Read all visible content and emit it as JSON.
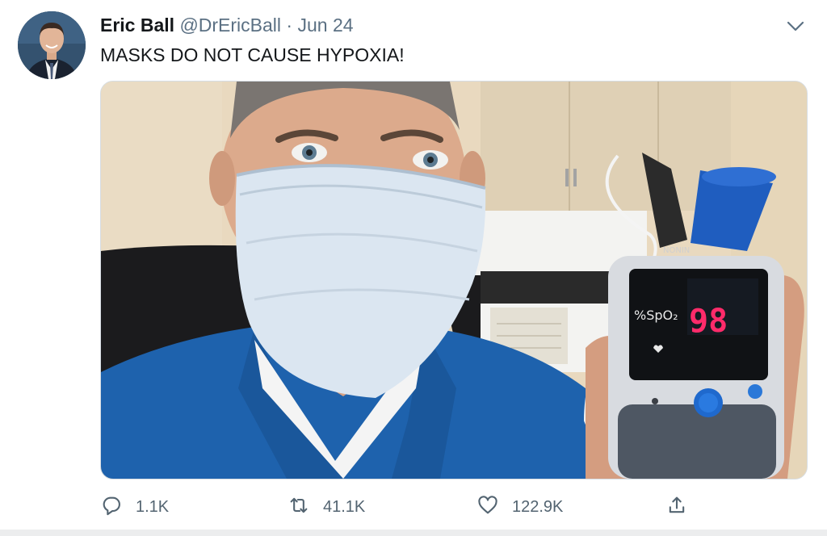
{
  "tweet": {
    "author_name": "Eric Ball",
    "handle": "@DrEricBall",
    "separator": "·",
    "date": "Jun 24",
    "text": "MASKS DO NOT CAUSE HYPOXIA!"
  },
  "media": {
    "device_label": "%SpO₂",
    "device_reading": "98",
    "device_brand": "NONIN"
  },
  "actions": {
    "reply_count": "1.1K",
    "retweet_count": "41.1K",
    "like_count": "122.9K"
  },
  "icons": {
    "reply": "reply-icon",
    "retweet": "retweet-icon",
    "like": "heart-icon",
    "share": "share-icon",
    "more": "chevron-down-icon"
  },
  "colors": {
    "secondary_text": "#5b7083",
    "icon": "#536471",
    "scrubs": "#1e62ad",
    "oximeter_display": "#ff2b6a",
    "oximeter_button": "#2a78d8"
  }
}
